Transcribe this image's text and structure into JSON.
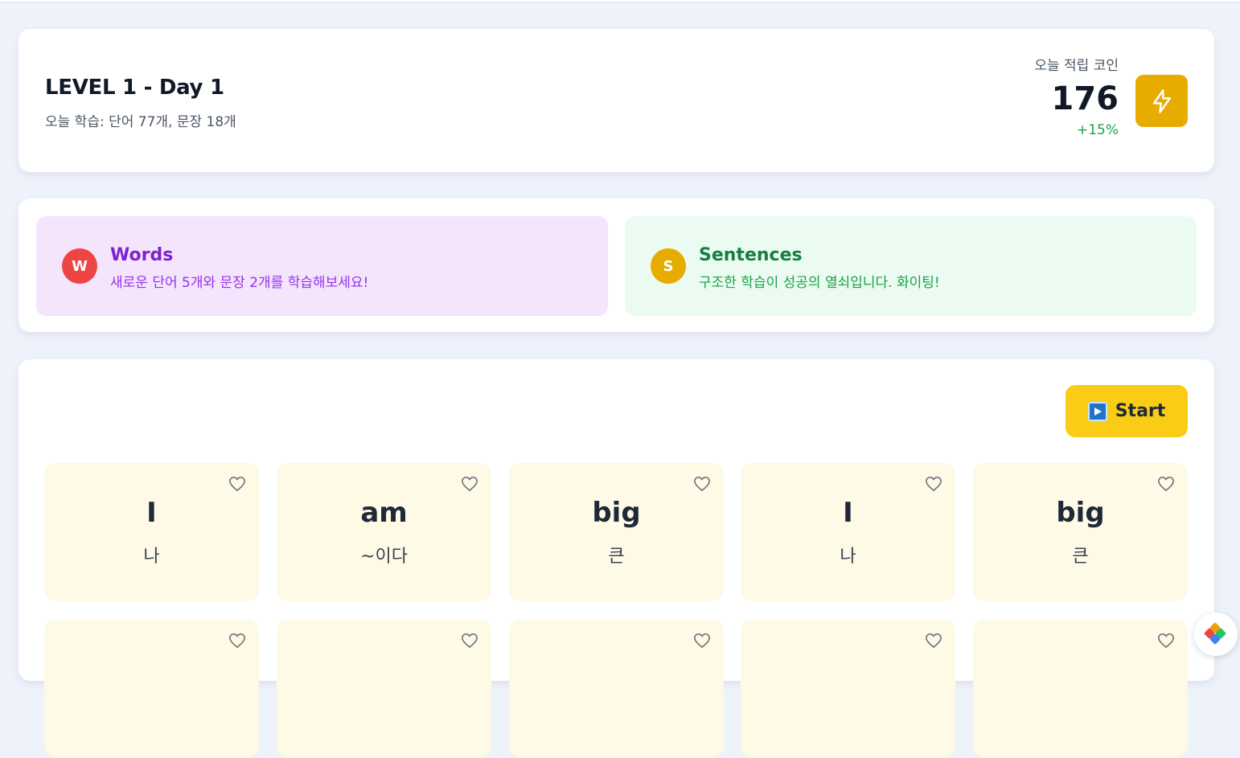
{
  "header": {
    "title": "LEVEL 1 - Day 1",
    "subtitle": "오늘 학습: 단어 77개, 문장 18개",
    "coin_label": "오늘 적립 코인",
    "coin_value": "176",
    "coin_delta": "+15%",
    "bolt_icon": "lightning-bolt-icon"
  },
  "info": {
    "words": {
      "badge": "W",
      "title": "Words",
      "desc": "새로운 단어 5개와 문장 2개를 학습해보세요!",
      "badge_color": "#ef4444",
      "text_color": "#7e22ce",
      "bg_color": "#f4e5fd"
    },
    "sentences": {
      "badge": "S",
      "title": "Sentences",
      "desc": "구조한 학습이 성공의 열쇠입니다. 화이팅!",
      "badge_color": "#e6ad00",
      "text_color": "#15803d",
      "bg_color": "#ecfbf1"
    }
  },
  "start_button": {
    "label": "Start",
    "icon": "play-icon"
  },
  "word_cards": [
    {
      "en": "I",
      "ko": "나"
    },
    {
      "en": "am",
      "ko": "~이다"
    },
    {
      "en": "big",
      "ko": "큰"
    },
    {
      "en": "I",
      "ko": "나"
    },
    {
      "en": "big",
      "ko": "큰"
    },
    {
      "en": "",
      "ko": ""
    },
    {
      "en": "",
      "ko": ""
    },
    {
      "en": "",
      "ko": ""
    },
    {
      "en": "",
      "ko": ""
    },
    {
      "en": "",
      "ko": ""
    }
  ],
  "colors": {
    "accent_yellow": "#facc15",
    "bolt_bg": "#e6ad00",
    "positive": "#16a34a",
    "tile_bg": "#fefae6"
  }
}
